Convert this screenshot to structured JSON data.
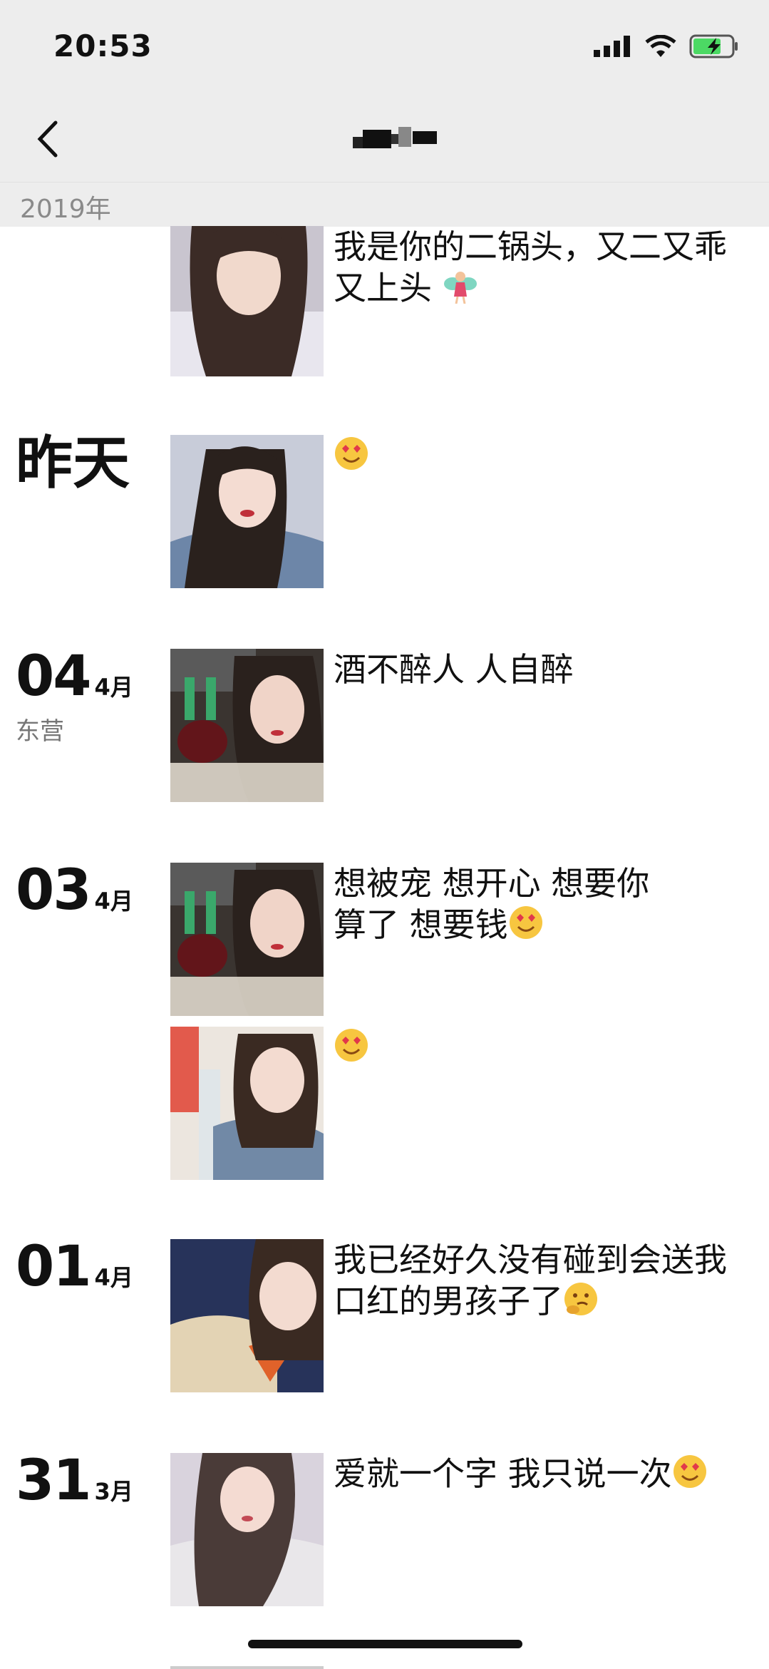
{
  "status": {
    "time": "20:53"
  },
  "nav": {
    "back_icon": "chevron-left-icon",
    "title": ""
  },
  "year_header": "2019年",
  "entries": [
    {
      "day": "",
      "month": "",
      "location": "",
      "text": "我是你的二锅头，又二又乖又上头",
      "emoji": "fairy"
    },
    {
      "day_label": "昨天",
      "text": "",
      "emoji": "heart-eyes"
    },
    {
      "day": "04",
      "month": "4月",
      "location": "东营",
      "text": "酒不醉人 人自醉"
    },
    {
      "day": "03",
      "month": "4月",
      "location": "",
      "text": "想被宠 想开心 想要你算了 想要钱",
      "emoji": "heart-eyes"
    },
    {
      "text": "",
      "emoji": "heart-eyes"
    },
    {
      "day": "01",
      "month": "4月",
      "location": "",
      "text": "我已经好久没有碰到会送我口红的男孩子了",
      "emoji": "hmm"
    },
    {
      "day": "31",
      "month": "3月",
      "location": "",
      "text": "爱就一个字 我只说一次",
      "emoji": "heart-eyes"
    }
  ],
  "colors": {
    "bar_bg": "#ededed",
    "text": "#111111",
    "muted": "#8a8a8a"
  }
}
